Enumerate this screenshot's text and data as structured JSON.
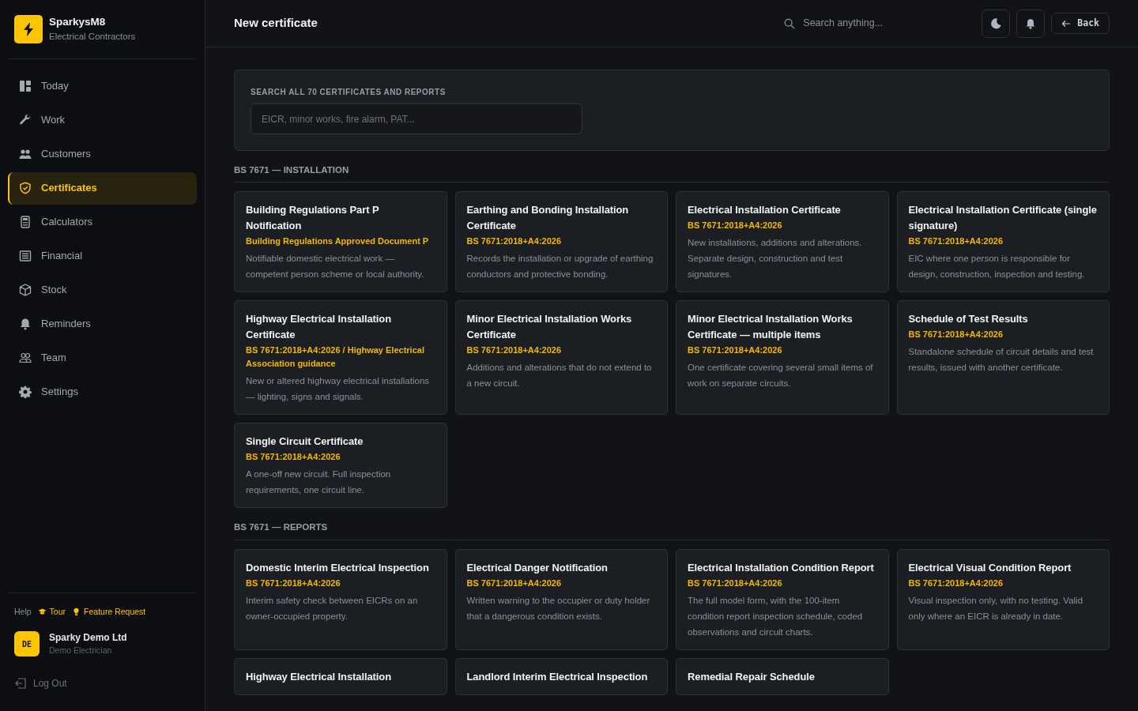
{
  "brand": {
    "name": "SparkysM8",
    "tagline": "Electrical Contractors"
  },
  "nav": [
    {
      "label": "Today",
      "selected": false
    },
    {
      "label": "Work",
      "selected": false
    },
    {
      "label": "Customers",
      "selected": false
    },
    {
      "label": "Certificates",
      "selected": true
    },
    {
      "label": "Calculators",
      "selected": false
    },
    {
      "label": "Financial",
      "selected": false
    },
    {
      "label": "Stock",
      "selected": false
    },
    {
      "label": "Reminders",
      "selected": false
    },
    {
      "label": "Team",
      "selected": false
    },
    {
      "label": "Settings",
      "selected": false
    }
  ],
  "help": {
    "label": "Help",
    "links": [
      {
        "label": "Tour"
      },
      {
        "label": "Feature Request"
      }
    ]
  },
  "user": {
    "initials": "DE",
    "name": "Sparky Demo Ltd",
    "role": "Demo Electrician"
  },
  "logout": "Log Out",
  "header": {
    "title": "New certificate",
    "search_placeholder": "Search anything...",
    "back": "Back"
  },
  "search_panel": {
    "label": "SEARCH ALL 70 CERTIFICATES AND REPORTS",
    "placeholder": "EICR, minor works, fire alarm, PAT..."
  },
  "sections": [
    {
      "title": "BS 7671 — INSTALLATION",
      "cards": [
        {
          "title": "Building Regulations Part P Notification",
          "standard": "Building Regulations Approved Document P",
          "description": "Notifiable domestic electrical work — competent person scheme or local authority."
        },
        {
          "title": "Earthing and Bonding Installation Certificate",
          "standard": "BS 7671:2018+A4:2026",
          "description": "Records the installation or upgrade of earthing conductors and protective bonding."
        },
        {
          "title": "Electrical Installation Certificate",
          "standard": "BS 7671:2018+A4:2026",
          "description": "New installations, additions and alterations. Separate design, construction and test signatures."
        },
        {
          "title": "Electrical Installation Certificate (single signature)",
          "standard": "BS 7671:2018+A4:2026",
          "description": "EIC where one person is responsible for design, construction, inspection and testing."
        },
        {
          "title": "Highway Electrical Installation Certificate",
          "standard": "BS 7671:2018+A4:2026 / Highway Electrical Association guidance",
          "description": "New or altered highway electrical installations — lighting, signs and signals."
        },
        {
          "title": "Minor Electrical Installation Works Certificate",
          "standard": "BS 7671:2018+A4:2026",
          "description": "Additions and alterations that do not extend to a new circuit."
        },
        {
          "title": "Minor Electrical Installation Works Certificate — multiple items",
          "standard": "BS 7671:2018+A4:2026",
          "description": "One certificate covering several small items of work on separate circuits."
        },
        {
          "title": "Schedule of Test Results",
          "standard": "BS 7671:2018+A4:2026",
          "description": "Standalone schedule of circuit details and test results, issued with another certificate."
        },
        {
          "title": "Single Circuit Certificate",
          "standard": "BS 7671:2018+A4:2026",
          "description": "A one-off new circuit. Full inspection requirements, one circuit line."
        }
      ]
    },
    {
      "title": "BS 7671 — REPORTS",
      "cards": [
        {
          "title": "Domestic Interim Electrical Inspection",
          "standard": "BS 7671:2018+A4:2026",
          "description": "Interim safety check between EICRs on an owner-occupied property."
        },
        {
          "title": "Electrical Danger Notification",
          "standard": "BS 7671:2018+A4:2026",
          "description": "Written warning to the occupier or duty holder that a dangerous condition exists."
        },
        {
          "title": "Electrical Installation Condition Report",
          "standard": "BS 7671:2018+A4:2026",
          "description": "The full model form, with the 100-item condition report inspection schedule, coded observations and circuit charts."
        },
        {
          "title": "Electrical Visual Condition Report",
          "standard": "BS 7671:2018+A4:2026",
          "description": "Visual inspection only, with no testing. Valid only where an EICR is already in date."
        },
        {
          "title": "Highway Electrical Installation"
        },
        {
          "title": "Landlord Interim Electrical Inspection"
        },
        {
          "title": "Remedial Repair Schedule"
        }
      ]
    }
  ]
}
